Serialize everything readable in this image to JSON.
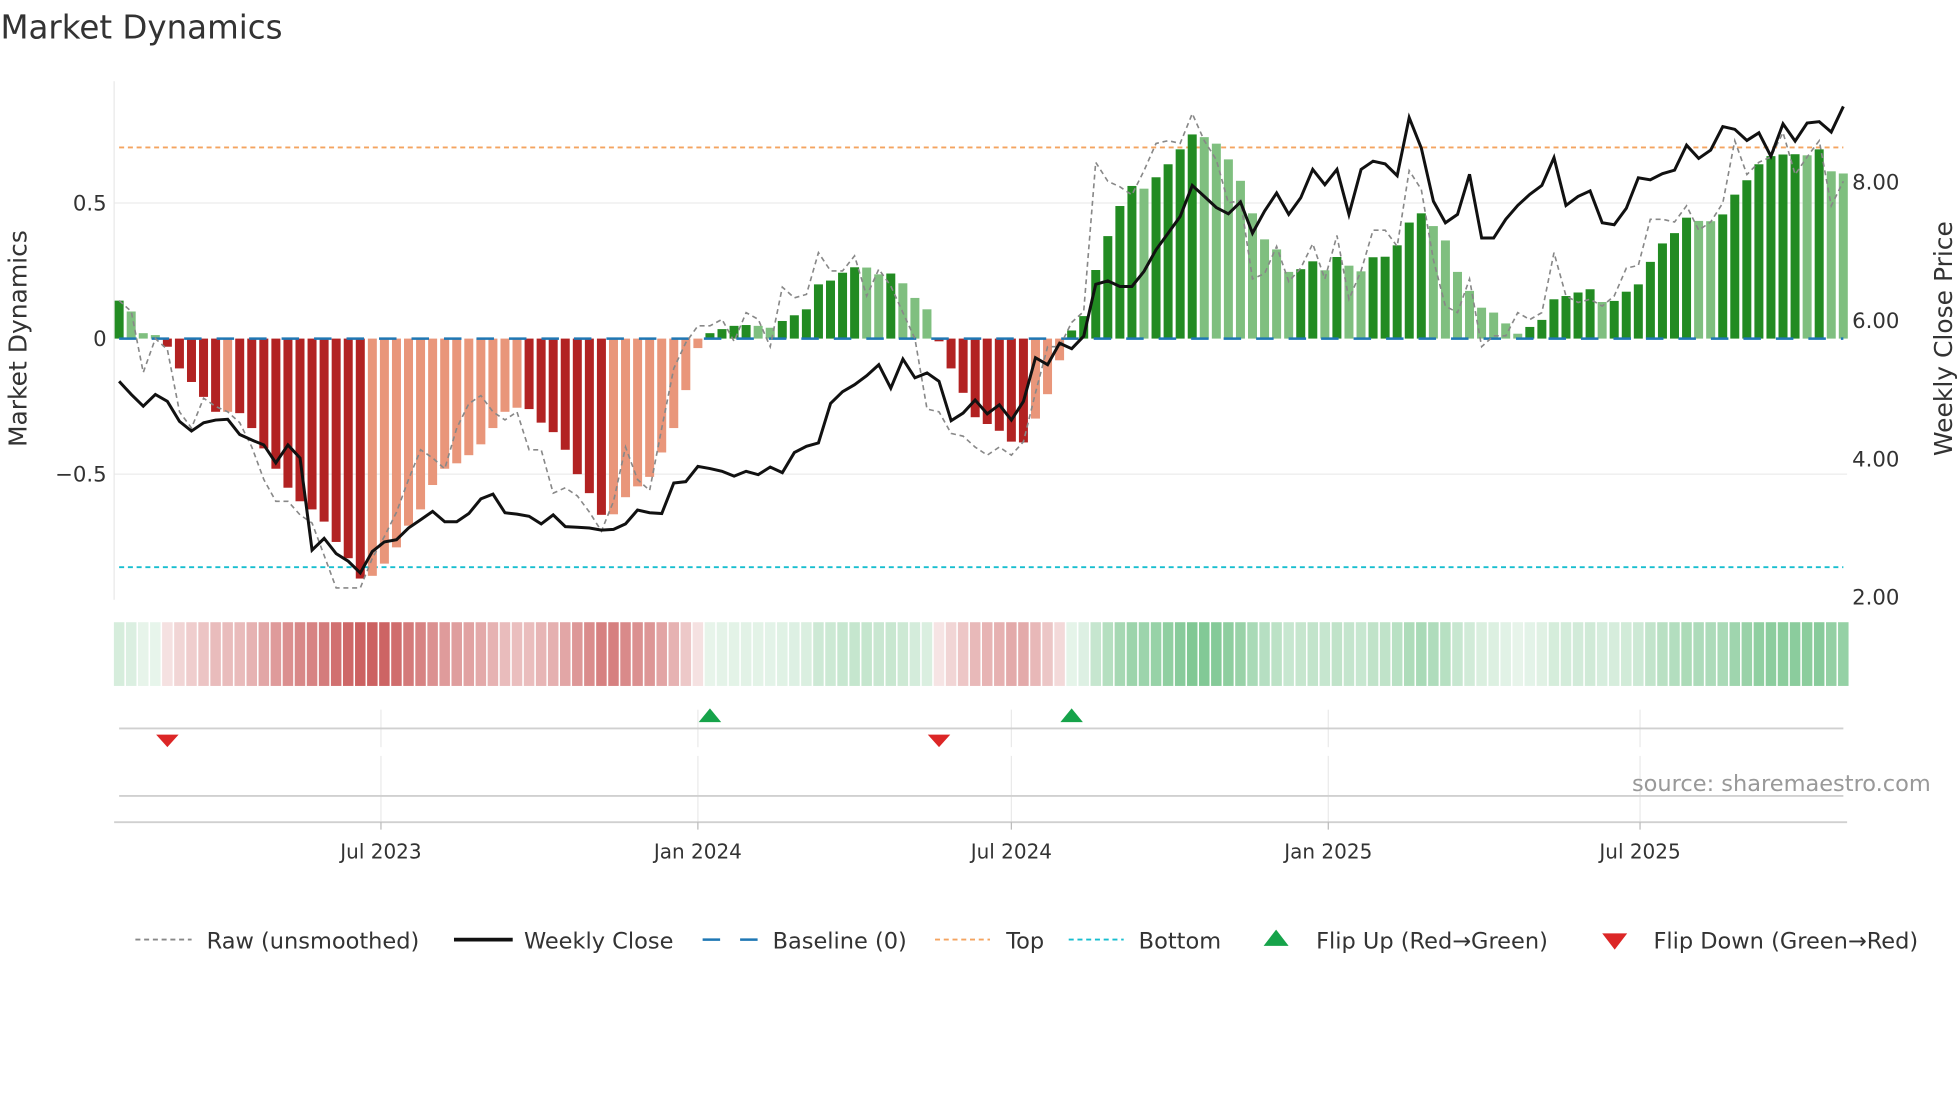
{
  "title": "Market Dynamics",
  "source": "source: sharemaestro.com",
  "colors": {
    "dark_green": "#228b22",
    "light_green": "#7fbf7f",
    "dark_red": "#b22222",
    "light_red": "#e9967a",
    "close": "#111111",
    "raw": "#888888",
    "baseline": "#1f77b4",
    "top": "#f4a460",
    "bottom": "#17becf",
    "flip_up": "#16a34a",
    "flip_down": "#dc2626"
  },
  "chart_data": {
    "type": "bar",
    "title": "Market Dynamics",
    "ylabel": "Market Dynamics",
    "y2label": "Weekly Close Price",
    "ylim": [
      -0.96,
      0.96
    ],
    "y2lim": [
      2.0,
      9.5
    ],
    "yticks": [
      {
        "v": 0.5,
        "label": "0.5"
      },
      {
        "v": 0,
        "label": "0"
      },
      {
        "v": -0.5,
        "label": "−0.5"
      }
    ],
    "y2ticks": [
      {
        "v": 8,
        "label": "8.00"
      },
      {
        "v": 6,
        "label": "6.00"
      },
      {
        "v": 4,
        "label": "4.00"
      },
      {
        "v": 2,
        "label": "2.00"
      }
    ],
    "x_start": "2023-01-30",
    "x_step_days": 7,
    "xticks": [
      {
        "date": "2023-07-01",
        "label": "Jul 2023"
      },
      {
        "date": "2024-01-01",
        "label": "Jan 2024"
      },
      {
        "date": "2024-07-01",
        "label": "Jul 2024"
      },
      {
        "date": "2025-01-01",
        "label": "Jan 2025"
      },
      {
        "date": "2025-07-01",
        "label": "Jul 2025"
      }
    ],
    "top_level": 0.705,
    "bottom_level": -0.843,
    "baseline": 0,
    "grid": true,
    "legend_position": "bottom",
    "series": [
      {
        "name": "Market Dynamics (smoothed)",
        "kind": "bar",
        "values": [
          0.14,
          0.1,
          0.02,
          0.013,
          -0.03,
          -0.11,
          -0.16,
          -0.215,
          -0.27,
          -0.27,
          -0.275,
          -0.33,
          -0.405,
          -0.48,
          -0.55,
          -0.6,
          -0.63,
          -0.675,
          -0.75,
          -0.81,
          -0.885,
          -0.875,
          -0.83,
          -0.77,
          -0.69,
          -0.63,
          -0.54,
          -0.48,
          -0.46,
          -0.43,
          -0.39,
          -0.33,
          -0.27,
          -0.255,
          -0.26,
          -0.31,
          -0.345,
          -0.41,
          -0.5,
          -0.57,
          -0.65,
          -0.648,
          -0.585,
          -0.545,
          -0.51,
          -0.42,
          -0.33,
          -0.19,
          -0.035,
          0.02,
          0.035,
          0.047,
          0.05,
          0.047,
          0.04,
          0.065,
          0.086,
          0.108,
          0.2,
          0.214,
          0.243,
          0.263,
          0.262,
          0.237,
          0.24,
          0.204,
          0.15,
          0.108,
          -0.01,
          -0.11,
          -0.2,
          -0.29,
          -0.315,
          -0.34,
          -0.38,
          -0.383,
          -0.295,
          -0.205,
          -0.08,
          0.03,
          0.083,
          0.253,
          0.378,
          0.489,
          0.563,
          0.553,
          0.595,
          0.643,
          0.698,
          0.753,
          0.743,
          0.719,
          0.661,
          0.582,
          0.462,
          0.366,
          0.329,
          0.246,
          0.256,
          0.285,
          0.252,
          0.301,
          0.269,
          0.248,
          0.3,
          0.302,
          0.344,
          0.428,
          0.462,
          0.415,
          0.362,
          0.246,
          0.176,
          0.114,
          0.096,
          0.056,
          0.018,
          0.043,
          0.069,
          0.145,
          0.157,
          0.17,
          0.182,
          0.135,
          0.139,
          0.173,
          0.2,
          0.283,
          0.351,
          0.389,
          0.446,
          0.434,
          0.433,
          0.458,
          0.531,
          0.584,
          0.643,
          0.673,
          0.679,
          0.68,
          0.676,
          0.698,
          0.617,
          0.609
        ]
      },
      {
        "name": "Raw (unsmoothed)",
        "kind": "line",
        "values": [
          0.14,
          0.1,
          -0.125,
          0,
          -0.04,
          -0.27,
          -0.33,
          -0.22,
          -0.25,
          -0.27,
          -0.31,
          -0.4,
          -0.52,
          -0.6,
          -0.6,
          -0.65,
          -0.68,
          -0.8,
          -0.92,
          -0.92,
          -0.92,
          -0.81,
          -0.73,
          -0.64,
          -0.52,
          -0.41,
          -0.44,
          -0.48,
          -0.33,
          -0.24,
          -0.21,
          -0.27,
          -0.3,
          -0.27,
          -0.41,
          -0.41,
          -0.57,
          -0.55,
          -0.58,
          -0.64,
          -0.71,
          -0.6,
          -0.4,
          -0.52,
          -0.56,
          -0.33,
          -0.11,
          -0.015,
          0.047,
          0.047,
          0.071,
          -0.01,
          0.096,
          0.071,
          -0.03,
          0.19,
          0.15,
          0.163,
          0.317,
          0.25,
          0.25,
          0.305,
          0.157,
          0.256,
          0.194,
          0.096,
          0.0,
          -0.26,
          -0.27,
          -0.35,
          -0.36,
          -0.4,
          -0.43,
          -0.4,
          -0.43,
          -0.38,
          -0.2,
          -0.03,
          -0.03,
          0.06,
          0.1,
          0.65,
          0.58,
          0.56,
          0.53,
          0.62,
          0.72,
          0.73,
          0.72,
          0.83,
          0.73,
          0.66,
          0.5,
          0.51,
          0.22,
          0.24,
          0.34,
          0.21,
          0.26,
          0.35,
          0.22,
          0.38,
          0.145,
          0.25,
          0.4,
          0.4,
          0.34,
          0.62,
          0.55,
          0.29,
          0.12,
          0.096,
          0.22,
          -0.03,
          0.01,
          0.01,
          0.096,
          0.07,
          0.096,
          0.317,
          0.157,
          0.133,
          0.145,
          0.12,
          0.157,
          0.26,
          0.27,
          0.44,
          0.44,
          0.43,
          0.49,
          0.4,
          0.43,
          0.5,
          0.73,
          0.605,
          0.65,
          0.67,
          0.76,
          0.605,
          0.67,
          0.73,
          0.49,
          0.58
        ]
      },
      {
        "name": "Weekly Close",
        "kind": "line",
        "axis": "right",
        "values": [
          5.12,
          4.93,
          4.76,
          4.93,
          4.83,
          4.54,
          4.4,
          4.52,
          4.56,
          4.57,
          4.35,
          4.27,
          4.2,
          3.94,
          4.2,
          4.01,
          2.68,
          2.85,
          2.63,
          2.52,
          2.35,
          2.66,
          2.8,
          2.83,
          3.0,
          3.12,
          3.24,
          3.09,
          3.09,
          3.21,
          3.42,
          3.49,
          3.22,
          3.2,
          3.17,
          3.06,
          3.19,
          3.02,
          3.01,
          3.0,
          2.97,
          2.98,
          3.06,
          3.26,
          3.22,
          3.21,
          3.65,
          3.67,
          3.89,
          3.86,
          3.82,
          3.75,
          3.82,
          3.77,
          3.88,
          3.8,
          4.09,
          4.18,
          4.23,
          4.8,
          4.97,
          5.07,
          5.2,
          5.36,
          5.02,
          5.44,
          5.17,
          5.24,
          5.12,
          4.55,
          4.66,
          4.85,
          4.65,
          4.78,
          4.56,
          4.83,
          5.46,
          5.36,
          5.67,
          5.59,
          5.77,
          6.52,
          6.57,
          6.49,
          6.49,
          6.71,
          7.02,
          7.26,
          7.5,
          7.95,
          7.79,
          7.63,
          7.54,
          7.71,
          7.26,
          7.58,
          7.84,
          7.53,
          7.77,
          8.18,
          7.96,
          8.18,
          7.53,
          8.18,
          8.3,
          8.26,
          8.09,
          8.93,
          8.49,
          7.72,
          7.41,
          7.53,
          8.11,
          7.19,
          7.19,
          7.46,
          7.66,
          7.82,
          7.95,
          8.35,
          7.66,
          7.79,
          7.87,
          7.41,
          7.38,
          7.62,
          8.06,
          8.03,
          8.12,
          8.17,
          8.53,
          8.34,
          8.46,
          8.8,
          8.76,
          8.6,
          8.71,
          8.37,
          8.84,
          8.59,
          8.85,
          8.87,
          8.72,
          9.09
        ]
      }
    ],
    "flips": [
      {
        "date": "2023-02-27",
        "type": "down"
      },
      {
        "date": "2024-01-08",
        "type": "up"
      },
      {
        "date": "2024-05-20",
        "type": "down"
      },
      {
        "date": "2024-08-05",
        "type": "up"
      }
    ]
  },
  "legend": [
    {
      "label": "Raw (unsmoothed)",
      "symbol": "dashed-gray"
    },
    {
      "label": "Weekly Close",
      "symbol": "solid-black"
    },
    {
      "label": "Baseline (0)",
      "symbol": "dashed-blue"
    },
    {
      "label": "Top",
      "symbol": "dotted-orange"
    },
    {
      "label": "Bottom",
      "symbol": "dotted-cyan"
    },
    {
      "label": "Flip Up (Red→Green)",
      "symbol": "triangle-up"
    },
    {
      "label": "Flip Down (Green→Red)",
      "symbol": "triangle-down"
    }
  ]
}
